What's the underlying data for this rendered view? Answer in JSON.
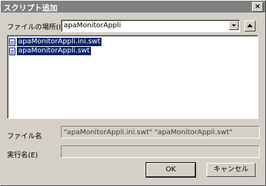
{
  "window": {
    "title": "スクリプト追加",
    "close_glyph": "×"
  },
  "location": {
    "label": "ファイルの場所(I)",
    "value": "apaMonitorAppli"
  },
  "files": [
    {
      "name": "apaMonitorAppli.ini.swt",
      "icon": "file-icon"
    },
    {
      "name": "apaMonitorAppli.swt",
      "icon": "file-icon"
    }
  ],
  "filename": {
    "label": "ファイル名",
    "value": "\"apaMonitorAppli.ini.swt\" \"apaMonitorAppli.swt\""
  },
  "exec_name": {
    "label": "実行名(E)",
    "value": ""
  },
  "buttons": {
    "ok": "OK",
    "cancel": "キャンセル"
  }
}
